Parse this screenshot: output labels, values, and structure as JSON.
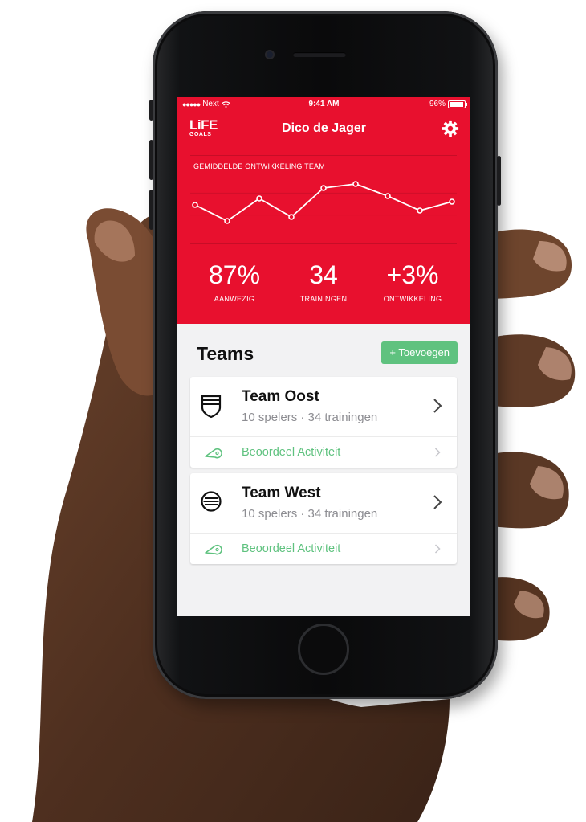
{
  "status_bar": {
    "carrier": "Next",
    "time": "9:41 AM",
    "battery": "96%"
  },
  "nav": {
    "logo_top": "LiFE",
    "logo_bottom": "GOALS",
    "title": "Dico de Jager",
    "settings_icon": "gear-icon"
  },
  "chart_data": {
    "type": "line",
    "title": "GEMIDDELDE ONTWIKKELING TEAM",
    "values": [
      3.7,
      1.7,
      4.5,
      2.2,
      5.8,
      6.3,
      4.8,
      3.0,
      4.1
    ],
    "ylim": [
      0,
      7
    ],
    "grid": true
  },
  "stats": [
    {
      "value": "87%",
      "label": "AANWEZIG"
    },
    {
      "value": "34",
      "label": "TRAININGEN"
    },
    {
      "value": "+3%",
      "label": "ONTWIKKELING"
    }
  ],
  "teams": {
    "title": "Teams",
    "add_label": "+ Toevoegen",
    "items": [
      {
        "name": "Team Oost",
        "meta": "10 spelers · 34 trainingen",
        "icon": "shield-icon",
        "action": "Beoordeel Activiteit"
      },
      {
        "name": "Team West",
        "meta": "10 spelers · 34 trainingen",
        "icon": "ball-icon",
        "action": "Beoordeel Activiteit"
      }
    ]
  },
  "colors": {
    "header_red": "#e8102e",
    "accent_green": "#5fc27f"
  }
}
